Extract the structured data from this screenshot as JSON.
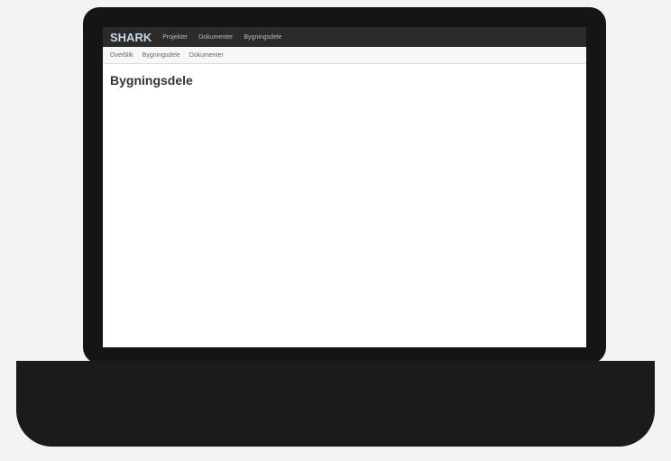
{
  "app": {
    "logo": "SHARK"
  },
  "topnav": {
    "items": [
      "Projekter",
      "Dokumenter",
      "Bygningsdele"
    ]
  },
  "tabs": [
    "Overblik",
    "Bygningsdele",
    "Dokumenter"
  ],
  "main": {
    "title": "Bygningsdele"
  }
}
